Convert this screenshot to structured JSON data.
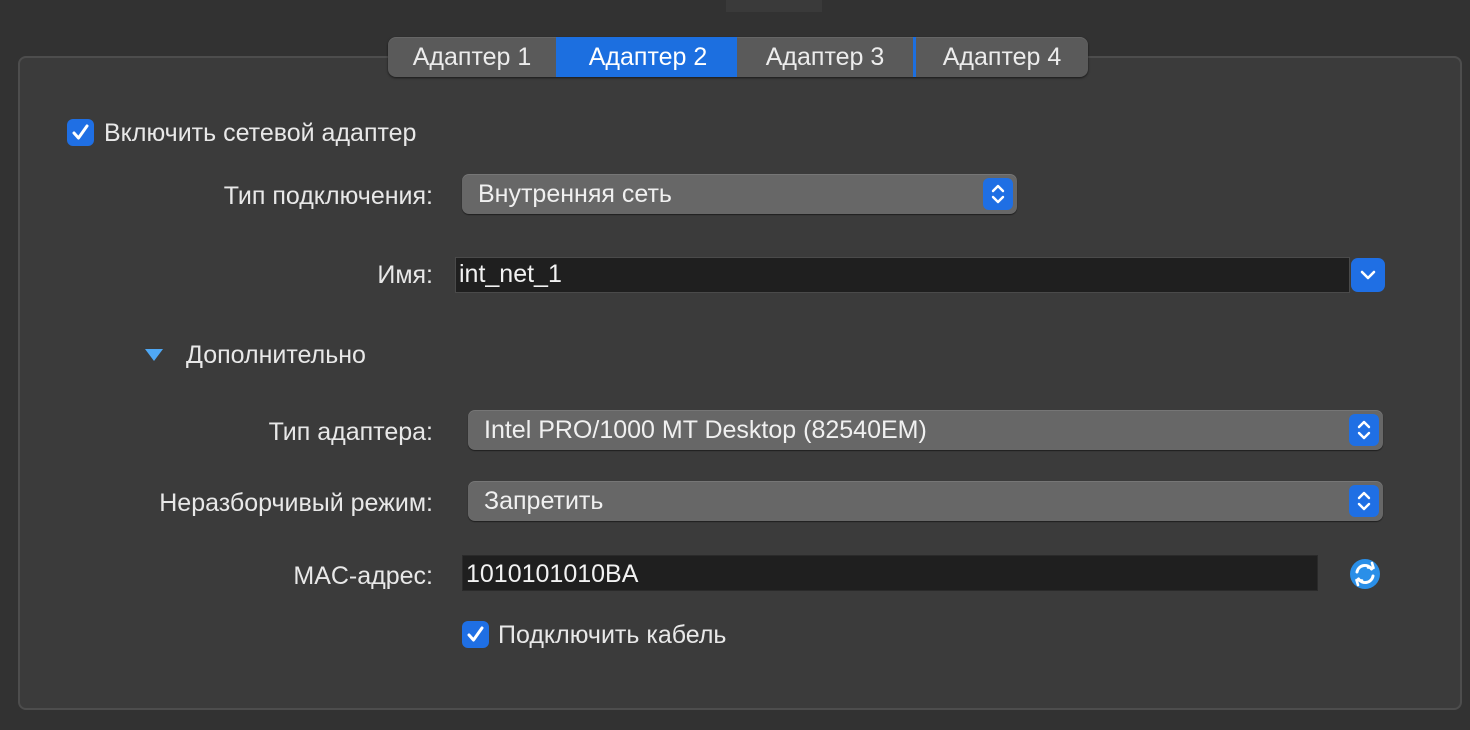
{
  "tabs": [
    {
      "label": "Адаптер 1",
      "active": false
    },
    {
      "label": "Адаптер 2",
      "active": true
    },
    {
      "label": "Адаптер 3",
      "active": false
    },
    {
      "label": "Адаптер 4",
      "active": false
    }
  ],
  "enable_adapter": {
    "label": "Включить сетевой адаптер",
    "checked": true
  },
  "attached_to": {
    "label": "Тип подключения:",
    "value": "Внутренняя сеть"
  },
  "name": {
    "label": "Имя:",
    "value": "int_net_1"
  },
  "advanced": {
    "label": "Дополнительно",
    "expanded": true
  },
  "adapter_type": {
    "label": "Тип адаптера:",
    "value": "Intel PRO/1000 MT Desktop (82540EM)"
  },
  "promiscuous": {
    "label": "Неразборчивый режим:",
    "value": "Запретить"
  },
  "mac": {
    "label": "MAC-адрес:",
    "value": "1010101010BA"
  },
  "cable": {
    "label": "Подключить кабель",
    "checked": true
  },
  "colors": {
    "accent": "#1f6fe4",
    "background": "#323232",
    "panel": "#3b3b3b"
  },
  "icons": {
    "check": "checkmark-icon",
    "stepper": "up-down-chevron-icon",
    "combo": "chevron-down-icon",
    "disclosure": "triangle-down-icon",
    "refresh": "refresh-icon"
  }
}
